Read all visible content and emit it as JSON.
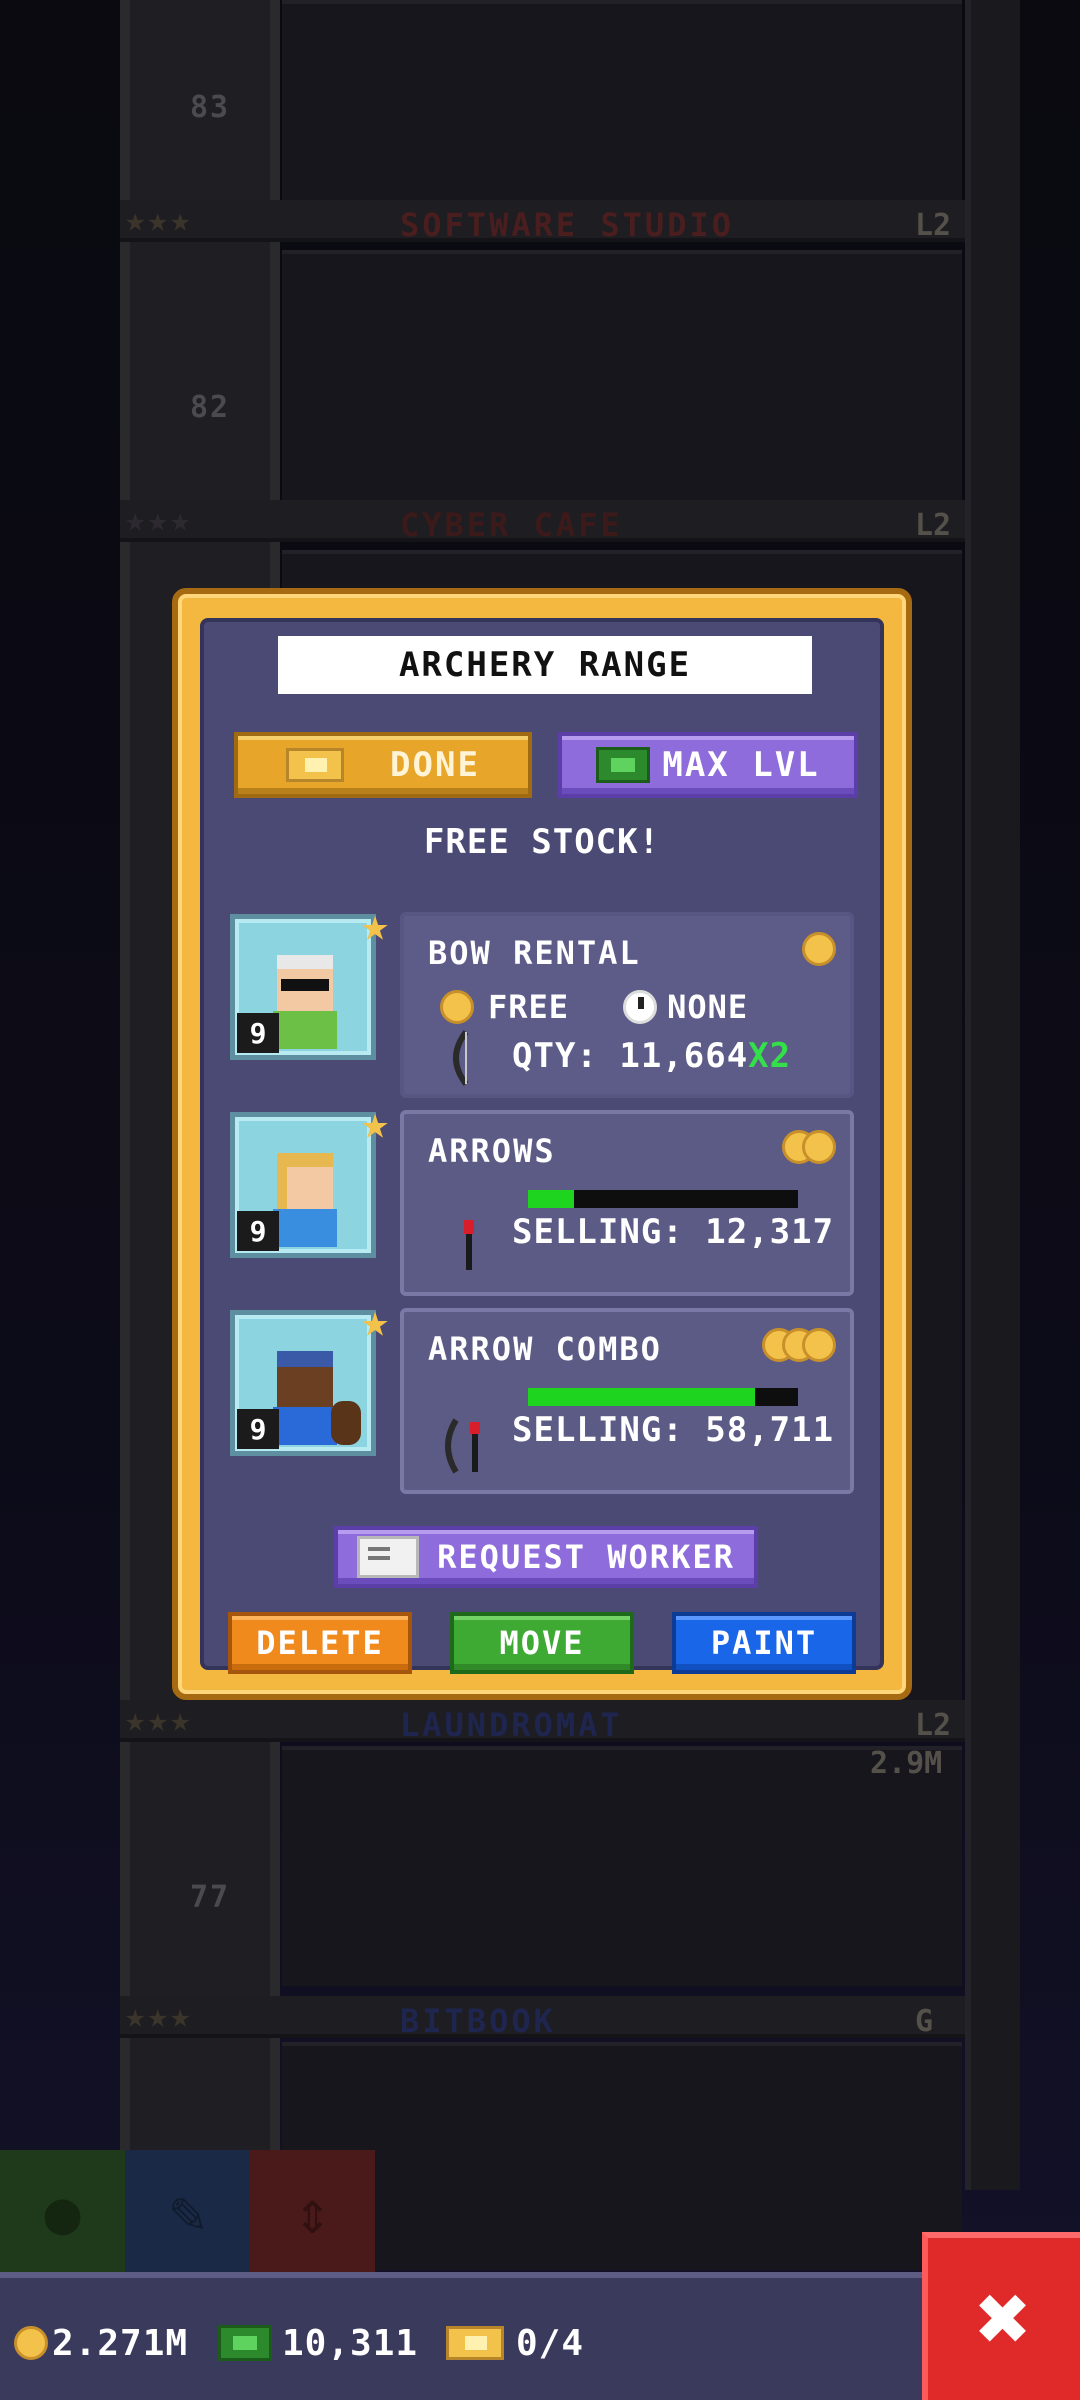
{
  "background_floors": [
    {
      "number": "83",
      "name": "SOFTWARE STUDIO",
      "name_color": "#4a1e1e",
      "level": "L2",
      "money": ""
    },
    {
      "number": "82",
      "name": "CYBER CAFE",
      "name_color": "#3d1a1a",
      "level": "L2",
      "money": ""
    },
    {
      "number": "77",
      "name": "LAUNDROMAT",
      "name_color": "#1e2650",
      "level": "L2",
      "money": "2.9M"
    },
    {
      "number": "",
      "name": "BITBOOK",
      "name_color": "#1e2650",
      "level": "G",
      "money": ""
    }
  ],
  "modal": {
    "title": "ARCHERY RANGE",
    "done_label": "DONE",
    "max_lvl_label": "MAX LVL",
    "subtitle": "FREE STOCK!",
    "workers": [
      {
        "level": "9",
        "hair": "#e8e8e8",
        "shirt": "#6cc046",
        "has_glasses": true
      },
      {
        "level": "9",
        "hair": "#e8b850",
        "shirt": "#3a8ee0",
        "has_glasses": false
      },
      {
        "level": "9",
        "hair": "#3a5aa8",
        "shirt": "#2a6ad8",
        "has_glasses": false
      }
    ],
    "products": [
      {
        "name": "BOW RENTAL",
        "price_label": "FREE",
        "time_label": "NONE",
        "qty_label": "QTY: 11,664",
        "bonus_label": "X2"
      },
      {
        "name": "ARROWS",
        "selling_label": "SELLING: 12,317",
        "progress": 0.17
      },
      {
        "name": "ARROW COMBO",
        "selling_label": "SELLING: 58,711",
        "progress": 0.84
      }
    ],
    "request_worker_label": "REQUEST WORKER",
    "delete_label": "DELETE",
    "move_label": "MOVE",
    "paint_label": "PAINT"
  },
  "status": {
    "coins": "2.271M",
    "bux": "10,311",
    "tickets": "0/4"
  },
  "icons": {
    "close": "close-icon",
    "coin": "coin-icon",
    "bux": "bux-icon",
    "ticket": "golden-ticket-icon",
    "star": "star-icon",
    "clock": "clock-icon",
    "letter": "letter-icon"
  }
}
